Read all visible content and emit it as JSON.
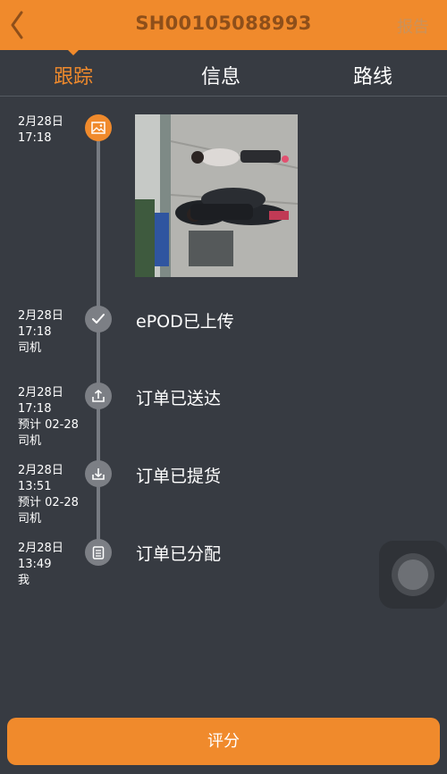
{
  "header": {
    "title": "SH00105088993",
    "report_label": "报告",
    "back_icon": "chevron-left-icon"
  },
  "tabs": [
    {
      "label": "跟踪",
      "active": true
    },
    {
      "label": "信息",
      "active": false
    },
    {
      "label": "路线",
      "active": false
    }
  ],
  "timeline": [
    {
      "date": "2月28日",
      "time": "17:18",
      "lines": [],
      "icon": "image-icon",
      "label": "",
      "has_photo": true
    },
    {
      "date": "2月28日",
      "time": "17:18",
      "lines": [
        "司机"
      ],
      "icon": "check-icon",
      "label": "ePOD已上传"
    },
    {
      "date": "2月28日",
      "time": "17:18",
      "lines": [
        "预计 02-28",
        "司机"
      ],
      "icon": "upload-icon",
      "label": "订单已送达"
    },
    {
      "date": "2月28日",
      "time": "13:51",
      "lines": [
        "预计 02-28",
        "司机"
      ],
      "icon": "download-icon",
      "label": "订单已提货"
    },
    {
      "date": "2月28日",
      "time": "13:49",
      "lines": [
        "我"
      ],
      "icon": "clipboard-icon",
      "label": "订单已分配"
    }
  ],
  "rate_button": {
    "label": "评分"
  },
  "colors": {
    "accent": "#f08a2c",
    "background": "#373b42"
  }
}
